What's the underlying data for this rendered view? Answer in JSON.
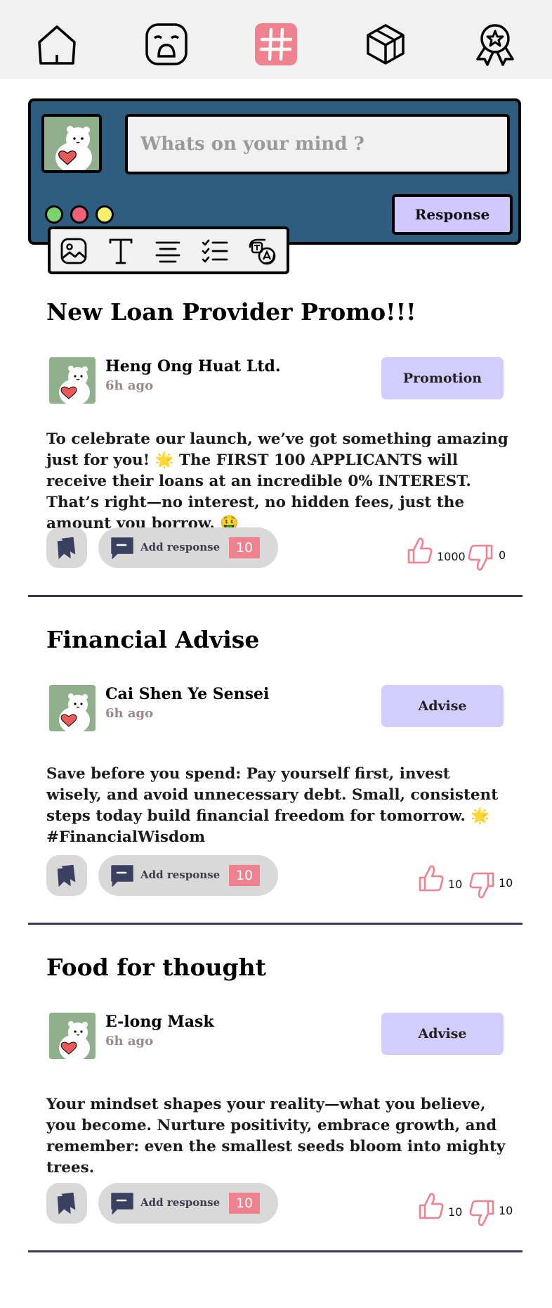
{
  "colors": {
    "nav_bg": "#f1f1f1",
    "active_tab": "#f0828f",
    "composer_bg": "#2f5d80",
    "badge_bg": "#d2cdfc",
    "accent_pink": "#f0828f",
    "divider": "#343c5a"
  },
  "nav": {
    "items": [
      {
        "icon": "home-icon",
        "active": false
      },
      {
        "icon": "sad-face-icon",
        "active": false
      },
      {
        "icon": "hashtag-icon",
        "active": true
      },
      {
        "icon": "cube-icon",
        "active": false
      },
      {
        "icon": "award-badge-icon",
        "active": false
      }
    ]
  },
  "composer": {
    "placeholder": "Whats on your mind ?",
    "response_label": "Response",
    "window_dots": [
      "#7bd36b",
      "#f0607a",
      "#f7f06a"
    ],
    "format_tools": [
      "image-icon",
      "text-icon",
      "align-icon",
      "checklist-icon",
      "translate-icon"
    ]
  },
  "posts": [
    {
      "title": "New Loan Provider Promo!!!",
      "author": "Heng Ong Huat Ltd.",
      "time": "6h ago",
      "tag": "Promotion",
      "body": "To celebrate our launch, we’ve got something amazing just for you! 🌟 The FIRST 100 APPLICANTS will receive their loans at an incredible 0% INTEREST. That’s right—no interest, no hidden fees, just the amount you borrow. 🤑",
      "add_response_label": "Add response",
      "response_count": "10",
      "likes": "1000",
      "dislikes": "0"
    },
    {
      "title": "Financial Advise",
      "author": "Cai Shen Ye Sensei",
      "time": "6h ago",
      "tag": "Advise",
      "body": "Save before you spend: Pay yourself first, invest wisely, and avoid unnecessary debt. Small, consistent steps today build financial freedom for tomorrow. 🌟 #FinancialWisdom",
      "add_response_label": "Add response",
      "response_count": "10",
      "likes": "10",
      "dislikes": "10"
    },
    {
      "title": "Food for thought",
      "author": "E-long Mask",
      "time": "6h ago",
      "tag": "Advise",
      "body": "Your mindset shapes your reality—what you believe, you become. Nurture positivity, embrace growth, and remember: even the smallest seeds bloom into mighty trees.",
      "add_response_label": "Add response",
      "response_count": "10",
      "likes": "10",
      "dislikes": "10"
    }
  ]
}
